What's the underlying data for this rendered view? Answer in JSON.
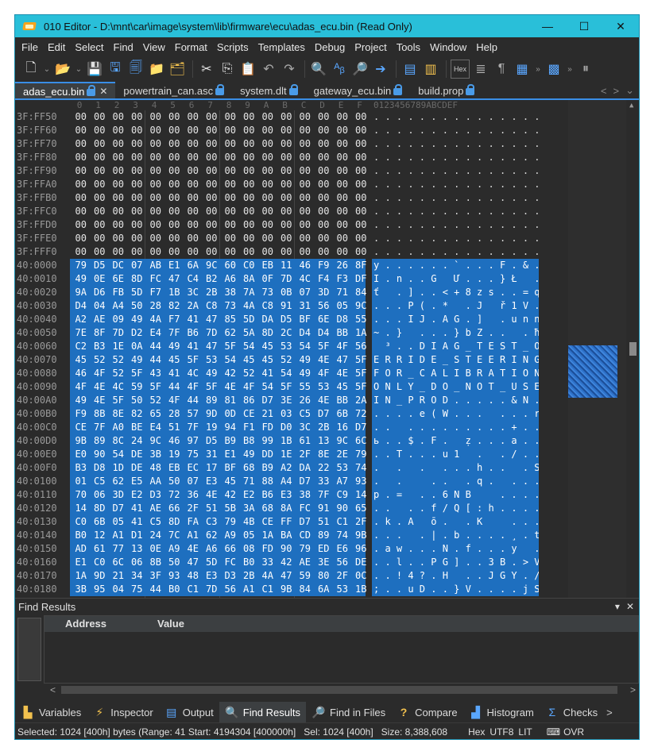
{
  "window": {
    "title": "010 Editor - D:\\mnt\\car\\image\\system\\lib\\firmware\\ecu\\adas_ecu.bin (Read Only)",
    "controls": {
      "minimize": "—",
      "maximize": "☐",
      "close": "✕"
    }
  },
  "menu": [
    "File",
    "Edit",
    "Select",
    "Find",
    "View",
    "Format",
    "Scripts",
    "Templates",
    "Debug",
    "Project",
    "Tools",
    "Window",
    "Help"
  ],
  "toolbar": {
    "hex_label": "Hex",
    "buttons": [
      "new-file",
      "open-file",
      "save",
      "save-as",
      "save-all",
      "open-folder",
      "copy-files",
      "cut",
      "copy",
      "paste",
      "undo",
      "redo",
      "find",
      "replace",
      "goto",
      "run-script",
      "run-template",
      "hex-mode",
      "calculator",
      "pilcrow",
      "columns",
      "more",
      "pause"
    ]
  },
  "tabs": [
    {
      "label": "adas_ecu.bin",
      "active": true,
      "locked": true,
      "closable": true
    },
    {
      "label": "powertrain_can.asc",
      "active": false,
      "locked": true
    },
    {
      "label": "system.dlt",
      "active": false,
      "locked": true
    },
    {
      "label": "gateway_ecu.bin",
      "active": false,
      "locked": true
    },
    {
      "label": "build.prop",
      "active": false,
      "locked": true
    }
  ],
  "tab_nav": {
    "prev": "<",
    "next": ">",
    "menu": "⌄"
  },
  "editor": {
    "hex_columns": [
      "0",
      "1",
      "2",
      "3",
      "4",
      "5",
      "6",
      "7",
      "8",
      "9",
      "A",
      "B",
      "C",
      "D",
      "E",
      "F"
    ],
    "text_column_header": "0123456789ABCDEF",
    "rows": [
      {
        "addr": "3F:FF50",
        "hex": [
          "00",
          "00",
          "00",
          "00",
          "00",
          "00",
          "00",
          "00",
          "00",
          "00",
          "00",
          "00",
          "00",
          "00",
          "00",
          "00"
        ],
        "text": ". . . . . . . . . . . . . . . .",
        "selected": false
      },
      {
        "addr": "3F:FF60",
        "hex": [
          "00",
          "00",
          "00",
          "00",
          "00",
          "00",
          "00",
          "00",
          "00",
          "00",
          "00",
          "00",
          "00",
          "00",
          "00",
          "00"
        ],
        "text": ". . . . . . . . . . . . . . . .",
        "selected": false
      },
      {
        "addr": "3F:FF70",
        "hex": [
          "00",
          "00",
          "00",
          "00",
          "00",
          "00",
          "00",
          "00",
          "00",
          "00",
          "00",
          "00",
          "00",
          "00",
          "00",
          "00"
        ],
        "text": ". . . . . . . . . . . . . . . .",
        "selected": false
      },
      {
        "addr": "3F:FF80",
        "hex": [
          "00",
          "00",
          "00",
          "00",
          "00",
          "00",
          "00",
          "00",
          "00",
          "00",
          "00",
          "00",
          "00",
          "00",
          "00",
          "00"
        ],
        "text": ". . . . . . . . . . . . . . . .",
        "selected": false
      },
      {
        "addr": "3F:FF90",
        "hex": [
          "00",
          "00",
          "00",
          "00",
          "00",
          "00",
          "00",
          "00",
          "00",
          "00",
          "00",
          "00",
          "00",
          "00",
          "00",
          "00"
        ],
        "text": ". . . . . . . . . . . . . . . .",
        "selected": false
      },
      {
        "addr": "3F:FFA0",
        "hex": [
          "00",
          "00",
          "00",
          "00",
          "00",
          "00",
          "00",
          "00",
          "00",
          "00",
          "00",
          "00",
          "00",
          "00",
          "00",
          "00"
        ],
        "text": ". . . . . . . . . . . . . . . .",
        "selected": false
      },
      {
        "addr": "3F:FFB0",
        "hex": [
          "00",
          "00",
          "00",
          "00",
          "00",
          "00",
          "00",
          "00",
          "00",
          "00",
          "00",
          "00",
          "00",
          "00",
          "00",
          "00"
        ],
        "text": ". . . . . . . . . . . . . . . .",
        "selected": false
      },
      {
        "addr": "3F:FFC0",
        "hex": [
          "00",
          "00",
          "00",
          "00",
          "00",
          "00",
          "00",
          "00",
          "00",
          "00",
          "00",
          "00",
          "00",
          "00",
          "00",
          "00"
        ],
        "text": ". . . . . . . . . . . . . . . .",
        "selected": false
      },
      {
        "addr": "3F:FFD0",
        "hex": [
          "00",
          "00",
          "00",
          "00",
          "00",
          "00",
          "00",
          "00",
          "00",
          "00",
          "00",
          "00",
          "00",
          "00",
          "00",
          "00"
        ],
        "text": ". . . . . . . . . . . . . . . .",
        "selected": false
      },
      {
        "addr": "3F:FFE0",
        "hex": [
          "00",
          "00",
          "00",
          "00",
          "00",
          "00",
          "00",
          "00",
          "00",
          "00",
          "00",
          "00",
          "00",
          "00",
          "00",
          "00"
        ],
        "text": ". . . . . . . . . . . . . . . .",
        "selected": false
      },
      {
        "addr": "3F:FFF0",
        "hex": [
          "00",
          "00",
          "00",
          "00",
          "00",
          "00",
          "00",
          "00",
          "00",
          "00",
          "00",
          "00",
          "00",
          "00",
          "00",
          "00"
        ],
        "text": ". . . . . . . . . . . . . . . .",
        "selected": false
      },
      {
        "addr": "40:0000",
        "hex": [
          "79",
          "D5",
          "DC",
          "07",
          "AB",
          "E1",
          "6A",
          "9C",
          "60",
          "C0",
          "EB",
          "11",
          "46",
          "F9",
          "26",
          "8F"
        ],
        "text": "y . . . . . . ` . . . F . & .",
        "selected": true
      },
      {
        "addr": "40:0010",
        "hex": [
          "49",
          "0E",
          "6E",
          "8D",
          "FC",
          "47",
          "C4",
          "B2",
          "A6",
          "8A",
          "0F",
          "7D",
          "4C",
          "F4",
          "F3",
          "DF"
        ],
        "text": "I . n . . G   Ư . . . } Ł   . .",
        "selected": true
      },
      {
        "addr": "40:0020",
        "hex": [
          "9A",
          "D6",
          "FB",
          "5D",
          "F7",
          "1B",
          "3C",
          "2B",
          "38",
          "7A",
          "73",
          "0B",
          "07",
          "3D",
          "71",
          "84"
        ],
        "text": "ť   . ] . . < + 8 z s . . = q .",
        "selected": true
      },
      {
        "addr": "40:0030",
        "hex": [
          "D4",
          "04",
          "A4",
          "50",
          "28",
          "82",
          "2A",
          "C8",
          "73",
          "4A",
          "C8",
          "91",
          "31",
          "56",
          "05",
          "9C"
        ],
        "text": ". . . P ( . *   . J   ř 1 V . .",
        "selected": true
      },
      {
        "addr": "40:0040",
        "hex": [
          "A2",
          "AE",
          "09",
          "49",
          "4A",
          "F7",
          "41",
          "47",
          "85",
          "5D",
          "DA",
          "D5",
          "BF",
          "6E",
          "D8",
          "55"
        ],
        "text": ". . . I J . A G . ]   . u n n .",
        "selected": true
      },
      {
        "addr": "40:0050",
        "hex": [
          "7E",
          "8F",
          "7D",
          "D2",
          "E4",
          "7F",
          "B6",
          "7D",
          "62",
          "5A",
          "8D",
          "2C",
          "D4",
          "D4",
          "BB",
          "1A"
        ],
        "text": "~ . }   . . . } b Z . .   . ħ .",
        "selected": true
      },
      {
        "addr": "40:0060",
        "hex": [
          "C2",
          "B3",
          "1E",
          "0A",
          "44",
          "49",
          "41",
          "47",
          "5F",
          "54",
          "45",
          "53",
          "54",
          "5F",
          "4F",
          "56"
        ],
        "text": "  ³ . . D I A G _ T E S T _ O V",
        "selected": true
      },
      {
        "addr": "40:0070",
        "hex": [
          "45",
          "52",
          "52",
          "49",
          "44",
          "45",
          "5F",
          "53",
          "54",
          "45",
          "45",
          "52",
          "49",
          "4E",
          "47",
          "5F"
        ],
        "text": "E R R I D E _ S T E E R I N G _",
        "selected": true
      },
      {
        "addr": "40:0080",
        "hex": [
          "46",
          "4F",
          "52",
          "5F",
          "43",
          "41",
          "4C",
          "49",
          "42",
          "52",
          "41",
          "54",
          "49",
          "4F",
          "4E",
          "5F"
        ],
        "text": "F O R _ C A L I B R A T I O N _",
        "selected": true
      },
      {
        "addr": "40:0090",
        "hex": [
          "4F",
          "4E",
          "4C",
          "59",
          "5F",
          "44",
          "4F",
          "5F",
          "4E",
          "4F",
          "54",
          "5F",
          "55",
          "53",
          "45",
          "5F"
        ],
        "text": "O N L Y _ D O _ N O T _ U S E _",
        "selected": true
      },
      {
        "addr": "40:00A0",
        "hex": [
          "49",
          "4E",
          "5F",
          "50",
          "52",
          "4F",
          "44",
          "89",
          "81",
          "86",
          "D7",
          "3E",
          "26",
          "4E",
          "BB",
          "2A"
        ],
        "text": "I N _ P R O D . . . . . & N . *",
        "selected": true
      },
      {
        "addr": "40:00B0",
        "hex": [
          "F9",
          "8B",
          "8E",
          "82",
          "65",
          "28",
          "57",
          "9D",
          "0D",
          "CE",
          "21",
          "03",
          "C5",
          "D7",
          "6B",
          "72"
        ],
        "text": ". . . . e ( W . . .   . . . r",
        "selected": true
      },
      {
        "addr": "40:00C0",
        "hex": [
          "CE",
          "7F",
          "A0",
          "BE",
          "E4",
          "51",
          "7F",
          "19",
          "94",
          "F1",
          "FD",
          "D0",
          "3C",
          "2B",
          "16",
          "D7"
        ],
        "text": ". .   . . . . . . . . . + . .",
        "selected": true
      },
      {
        "addr": "40:00D0",
        "hex": [
          "9B",
          "89",
          "8C",
          "24",
          "9C",
          "46",
          "97",
          "D5",
          "B9",
          "B8",
          "99",
          "1B",
          "61",
          "13",
          "9C",
          "6C"
        ],
        "text": "ь . . $ . F .   ẓ . . . a . . l",
        "selected": true
      },
      {
        "addr": "40:00E0",
        "hex": [
          "E0",
          "90",
          "54",
          "DE",
          "3B",
          "19",
          "75",
          "31",
          "E1",
          "49",
          "DD",
          "1E",
          "2F",
          "8E",
          "2E",
          "79"
        ],
        "text": ". . T . . . u 1   .   . / . . y",
        "selected": true
      },
      {
        "addr": "40:00F0",
        "hex": [
          "B3",
          "D8",
          "1D",
          "DE",
          "48",
          "EB",
          "EC",
          "17",
          "BF",
          "68",
          "B9",
          "A2",
          "DA",
          "22",
          "53",
          "74"
        ],
        "text": ".   .   .   . . . h . .   . S t",
        "selected": true
      },
      {
        "addr": "40:0100",
        "hex": [
          "01",
          "C5",
          "62",
          "E5",
          "AA",
          "50",
          "07",
          "E3",
          "45",
          "71",
          "88",
          "A4",
          "D7",
          "33",
          "A7",
          "93"
        ],
        "text": ".   .     . .   . q .   . . .",
        "selected": true
      },
      {
        "addr": "40:0110",
        "hex": [
          "70",
          "06",
          "3D",
          "E2",
          "D3",
          "72",
          "36",
          "4E",
          "42",
          "E2",
          "B6",
          "E3",
          "38",
          "7F",
          "C9",
          "14"
        ],
        "text": "p . =   . . 6 N B     . . . .",
        "selected": true
      },
      {
        "addr": "40:0120",
        "hex": [
          "14",
          "8D",
          "D7",
          "41",
          "AE",
          "66",
          "2F",
          "51",
          "5B",
          "3A",
          "68",
          "8A",
          "FC",
          "91",
          "90",
          "65"
        ],
        "text": ". .   . . f / Q [ : h . . . . e",
        "selected": true
      },
      {
        "addr": "40:0130",
        "hex": [
          "C0",
          "6B",
          "05",
          "41",
          "C5",
          "8D",
          "FA",
          "C3",
          "79",
          "4B",
          "CE",
          "FF",
          "D7",
          "51",
          "C1",
          "2F"
        ],
        "text": ". k . A   ō .   . K     . . . /",
        "selected": true
      },
      {
        "addr": "40:0140",
        "hex": [
          "B0",
          "12",
          "A1",
          "D1",
          "24",
          "7C",
          "A1",
          "62",
          "A9",
          "05",
          "1A",
          "BA",
          "CD",
          "89",
          "74",
          "9B"
        ],
        "text": ". . .   . | . b . . . . ¸ . t .",
        "selected": true
      },
      {
        "addr": "40:0150",
        "hex": [
          "AD",
          "61",
          "77",
          "13",
          "0E",
          "A9",
          "4E",
          "A6",
          "66",
          "08",
          "FD",
          "90",
          "79",
          "ED",
          "E6",
          "96"
        ],
        "text": ". a w . . . N . f . . . y   .",
        "selected": true
      },
      {
        "addr": "40:0160",
        "hex": [
          "E1",
          "C0",
          "6C",
          "06",
          "8B",
          "50",
          "47",
          "5D",
          "FC",
          "B0",
          "33",
          "42",
          "AE",
          "3E",
          "56",
          "DE"
        ],
        "text": ". . l . . P G ] . . 3 B . > V",
        "selected": true
      },
      {
        "addr": "40:0170",
        "hex": [
          "1A",
          "9D",
          "21",
          "34",
          "3F",
          "93",
          "48",
          "E3",
          "D3",
          "2B",
          "4A",
          "47",
          "59",
          "80",
          "2F",
          "0C"
        ],
        "text": ". . ! 4 ? . H   . . J G Y . / .",
        "selected": true
      },
      {
        "addr": "40:0180",
        "hex": [
          "3B",
          "95",
          "04",
          "75",
          "44",
          "B0",
          "C1",
          "7D",
          "56",
          "A1",
          "C1",
          "9B",
          "84",
          "6A",
          "53",
          "1B"
        ],
        "text": "; . . u D . . } V . . . . j S .",
        "selected": true
      }
    ]
  },
  "find_results": {
    "title": "Find Results",
    "pin": "▾",
    "close": "✕",
    "columns": [
      "Address",
      "Value"
    ],
    "scroll_left": "<",
    "scroll_right": ">"
  },
  "panel_tabs": [
    {
      "label": "Variables",
      "icon": "variables-icon",
      "active": false
    },
    {
      "label": "Inspector",
      "icon": "inspector-icon",
      "active": false
    },
    {
      "label": "Output",
      "icon": "output-icon",
      "active": false
    },
    {
      "label": "Find Results",
      "icon": "find-results-icon",
      "active": true
    },
    {
      "label": "Find in Files",
      "icon": "find-in-files-icon",
      "active": false
    },
    {
      "label": "Compare",
      "icon": "compare-icon",
      "active": false
    },
    {
      "label": "Histogram",
      "icon": "histogram-icon",
      "active": false
    },
    {
      "label": "Checks",
      "icon": "checksum-icon",
      "active": false
    }
  ],
  "panel_tabs_more": ">",
  "status": {
    "selected": "Selected: 1024 [400h] bytes (Range: 41 Start: 4194304 [400000h]",
    "sel": "Sel: 1024 [400h]",
    "size": "Size: 8,388,608",
    "mode": "Hex",
    "encoding": "UTF8",
    "endian": "LIT",
    "insert_mode": "OVR"
  },
  "colors": {
    "title_bar": "#29bfd9",
    "selection": "#1e6fbf",
    "background": "#2b2b2b",
    "accent": "#3a8ee6"
  }
}
